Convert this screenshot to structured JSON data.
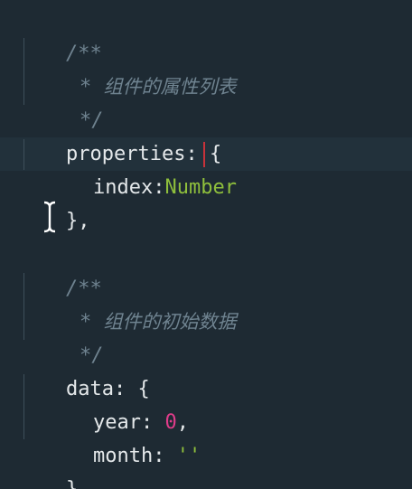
{
  "code": {
    "block1": {
      "comment_open": "/**",
      "comment_star": "*",
      "comment_text": "组件的属性列表",
      "comment_close": "*/",
      "key": "properties",
      "colon": ":",
      "brace_open": "{",
      "prop_name": "index",
      "prop_colon": ":",
      "prop_type": "Number",
      "brace_close": "},"
    },
    "block2": {
      "comment_open": "/**",
      "comment_star": "*",
      "comment_text": "组件的初始数据",
      "comment_close": "*/",
      "key": "data",
      "colon": ":",
      "brace_open": "{",
      "field1_name": "year",
      "field1_colon": ":",
      "field1_value": "0",
      "field1_comma": ",",
      "field2_name": "month",
      "field2_colon": ":",
      "field2_value": "''",
      "brace_close": "},"
    }
  },
  "colors": {
    "background": "#1e2a33",
    "text": "#e4e8ea",
    "comment": "#6f8390",
    "type": "#8fbf3c",
    "number": "#e03c8a",
    "string": "#8fbf3c",
    "caret": "#c8323a"
  },
  "icons": {
    "cursor": "text-cursor-icon"
  }
}
